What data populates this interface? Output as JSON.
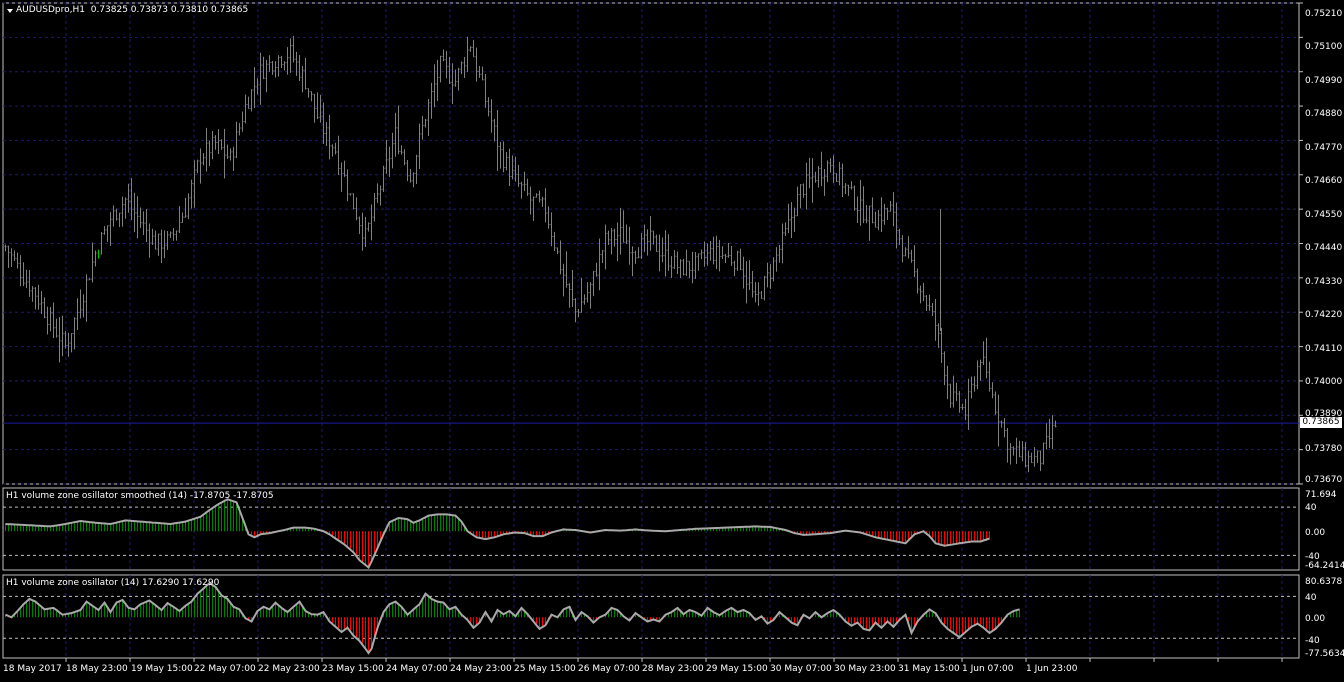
{
  "main_header": {
    "symbol_tf": "AUDUSDpro,H1",
    "ohlc": "0.73825 0.73873 0.73810 0.73865"
  },
  "osc1_header": "H1 volume zone osillator smoothed (14) -17.8705 -17.8705",
  "osc2_header": "H1 volume zone osillator (14) 17.6290 17.6290",
  "price_box": "0.73865",
  "colors": {
    "background": "#000000",
    "grid": "#1a1a70",
    "bars": "#808080",
    "last_up_bar": "#00c000",
    "positive": "#008000",
    "negative": "#ff0000",
    "oscillator_line": "#a9a9a9",
    "current_price_line": "#1a1aa0",
    "text": "#ffffff"
  },
  "chart_data": [
    {
      "type": "ohlc-bar",
      "title": "AUDUSDpro,H1",
      "ylim": [
        0.7367,
        0.7521
      ],
      "y_ticks": [
        "0.75210",
        "0.75100",
        "0.74990",
        "0.74880",
        "0.74770",
        "0.74660",
        "0.74550",
        "0.74440",
        "0.74330",
        "0.74220",
        "0.74110",
        "0.74000",
        "0.73890",
        "0.73780",
        "0.73670"
      ],
      "current_price": 0.73865,
      "x_ticks": [
        "18 May 2017",
        "18 May 23:00",
        "19 May 15:00",
        "22 May 07:00",
        "22 May 23:00",
        "23 May 15:00",
        "24 May 07:00",
        "24 May 23:00",
        "25 May 15:00",
        "26 May 07:00",
        "28 May 23:00",
        "29 May 15:00",
        "30 May 07:00",
        "30 May 23:00",
        "31 May 15:00",
        "1 Jun 07:00",
        "1 Jun 23:00"
      ],
      "close_anchors": [
        [
          0,
          0.7443
        ],
        [
          5,
          0.7435
        ],
        [
          10,
          0.7428
        ],
        [
          15,
          0.7419
        ],
        [
          20,
          0.7411
        ],
        [
          25,
          0.7425
        ],
        [
          30,
          0.7441
        ],
        [
          35,
          0.7452
        ],
        [
          40,
          0.7458
        ],
        [
          45,
          0.7451
        ],
        [
          50,
          0.7444
        ],
        [
          55,
          0.7445
        ],
        [
          60,
          0.7455
        ],
        [
          65,
          0.7472
        ],
        [
          70,
          0.7476
        ],
        [
          75,
          0.7471
        ],
        [
          80,
          0.7488
        ],
        [
          85,
          0.7499
        ],
        [
          90,
          0.7503
        ],
        [
          95,
          0.7505
        ],
        [
          100,
          0.7496
        ],
        [
          105,
          0.7482
        ],
        [
          110,
          0.7474
        ],
        [
          115,
          0.7459
        ],
        [
          120,
          0.7446
        ],
        [
          125,
          0.7462
        ],
        [
          130,
          0.7479
        ],
        [
          135,
          0.7465
        ],
        [
          140,
          0.7485
        ],
        [
          145,
          0.7501
        ],
        [
          150,
          0.7496
        ],
        [
          155,
          0.7508
        ],
        [
          160,
          0.749
        ],
        [
          165,
          0.7473
        ],
        [
          170,
          0.7464
        ],
        [
          175,
          0.7458
        ],
        [
          180,
          0.7455
        ],
        [
          185,
          0.7437
        ],
        [
          190,
          0.7422
        ],
        [
          195,
          0.743
        ],
        [
          200,
          0.7445
        ],
        [
          205,
          0.7447
        ],
        [
          210,
          0.7442
        ],
        [
          215,
          0.7445
        ],
        [
          220,
          0.744
        ],
        [
          225,
          0.7436
        ],
        [
          230,
          0.7437
        ],
        [
          235,
          0.7441
        ],
        [
          240,
          0.744
        ],
        [
          245,
          0.7438
        ],
        [
          250,
          0.7425
        ],
        [
          255,
          0.7435
        ],
        [
          260,
          0.7447
        ],
        [
          265,
          0.7461
        ],
        [
          270,
          0.7466
        ],
        [
          275,
          0.747
        ],
        [
          280,
          0.7462
        ],
        [
          285,
          0.7455
        ],
        [
          290,
          0.7452
        ],
        [
          295,
          0.7455
        ],
        [
          300,
          0.744
        ],
        [
          305,
          0.743
        ],
        [
          310,
          0.7418
        ],
        [
          315,
          0.7395
        ],
        [
          320,
          0.739
        ],
        [
          325,
          0.7408
        ],
        [
          330,
          0.7392
        ],
        [
          335,
          0.7378
        ],
        [
          340,
          0.7375
        ],
        [
          345,
          0.7375
        ],
        [
          350,
          0.7386
        ]
      ],
      "bar_count": 351
    },
    {
      "type": "histogram-line",
      "title": "H1 volume zone osillator smoothed (14)",
      "values_printed": [
        -17.8705,
        -17.8705
      ],
      "ylim": [
        -64.2414,
        71.694
      ],
      "y_ticks": [
        "71.694",
        "40",
        "0.00",
        "-40",
        "-64.2414"
      ],
      "levels": [
        40,
        -40
      ],
      "anchors": [
        [
          0,
          12
        ],
        [
          8,
          10
        ],
        [
          15,
          8
        ],
        [
          20,
          12
        ],
        [
          25,
          17
        ],
        [
          30,
          14
        ],
        [
          35,
          12
        ],
        [
          40,
          18
        ],
        [
          45,
          16
        ],
        [
          50,
          14
        ],
        [
          55,
          12
        ],
        [
          60,
          16
        ],
        [
          65,
          24
        ],
        [
          68,
          35
        ],
        [
          71,
          45
        ],
        [
          74,
          53
        ],
        [
          77,
          48
        ],
        [
          79,
          22
        ],
        [
          81,
          -5
        ],
        [
          83,
          -10
        ],
        [
          85,
          -5
        ],
        [
          88,
          -3
        ],
        [
          93,
          2
        ],
        [
          96,
          6
        ],
        [
          100,
          6
        ],
        [
          103,
          4
        ],
        [
          106,
          0
        ],
        [
          108,
          -5
        ],
        [
          110,
          -12
        ],
        [
          113,
          -22
        ],
        [
          116,
          -35
        ],
        [
          118,
          -48
        ],
        [
          120,
          -56
        ],
        [
          121,
          -60
        ],
        [
          122,
          -50
        ],
        [
          124,
          -28
        ],
        [
          126,
          -5
        ],
        [
          128,
          15
        ],
        [
          131,
          22
        ],
        [
          134,
          20
        ],
        [
          136,
          14
        ],
        [
          138,
          18
        ],
        [
          141,
          26
        ],
        [
          144,
          28
        ],
        [
          147,
          28
        ],
        [
          150,
          26
        ],
        [
          152,
          16
        ],
        [
          154,
          0
        ],
        [
          157,
          -10
        ],
        [
          160,
          -13
        ],
        [
          163,
          -10
        ],
        [
          166,
          -5
        ],
        [
          170,
          -2
        ],
        [
          173,
          -3
        ],
        [
          176,
          -8
        ],
        [
          179,
          -8
        ],
        [
          182,
          -2
        ],
        [
          186,
          3
        ],
        [
          190,
          2
        ],
        [
          195,
          -2
        ],
        [
          200,
          2
        ],
        [
          205,
          1
        ],
        [
          210,
          3
        ],
        [
          215,
          1
        ],
        [
          220,
          0
        ],
        [
          225,
          2
        ],
        [
          230,
          4
        ],
        [
          235,
          5
        ],
        [
          240,
          6
        ],
        [
          245,
          7
        ],
        [
          250,
          8
        ],
        [
          255,
          7
        ],
        [
          260,
          2
        ],
        [
          263,
          -3
        ],
        [
          266,
          -6
        ],
        [
          270,
          -5
        ],
        [
          275,
          -3
        ],
        [
          280,
          1
        ],
        [
          285,
          -2
        ],
        [
          290,
          -10
        ],
        [
          295,
          -15
        ],
        [
          298,
          -18
        ],
        [
          300,
          -20
        ],
        [
          303,
          -5
        ],
        [
          306,
          0
        ],
        [
          308,
          -8
        ],
        [
          310,
          -20
        ],
        [
          313,
          -24
        ],
        [
          318,
          -20
        ],
        [
          322,
          -17
        ],
        [
          325,
          -17
        ],
        [
          328,
          -12
        ]
      ]
    },
    {
      "type": "histogram-line",
      "title": "H1 volume zone osillator (14)",
      "values_printed": [
        17.629,
        17.629
      ],
      "ylim": [
        -77.5634,
        80.6378
      ],
      "y_ticks": [
        "80.6378",
        "40",
        "0.00",
        "-40",
        "-77.5634"
      ],
      "levels": [
        40,
        -40
      ],
      "anchors": [
        [
          0,
          5
        ],
        [
          2,
          0
        ],
        [
          4,
          12
        ],
        [
          6,
          25
        ],
        [
          8,
          35
        ],
        [
          10,
          30
        ],
        [
          13,
          15
        ],
        [
          16,
          18
        ],
        [
          19,
          5
        ],
        [
          22,
          8
        ],
        [
          25,
          14
        ],
        [
          27,
          30
        ],
        [
          29,
          22
        ],
        [
          31,
          14
        ],
        [
          33,
          28
        ],
        [
          35,
          10
        ],
        [
          37,
          28
        ],
        [
          39,
          33
        ],
        [
          41,
          18
        ],
        [
          43,
          15
        ],
        [
          45,
          25
        ],
        [
          48,
          32
        ],
        [
          50,
          23
        ],
        [
          52,
          14
        ],
        [
          54,
          27
        ],
        [
          56,
          20
        ],
        [
          58,
          12
        ],
        [
          60,
          22
        ],
        [
          62,
          30
        ],
        [
          64,
          45
        ],
        [
          66,
          55
        ],
        [
          68,
          65
        ],
        [
          70,
          58
        ],
        [
          72,
          42
        ],
        [
          74,
          35
        ],
        [
          76,
          20
        ],
        [
          78,
          15
        ],
        [
          80,
          -2
        ],
        [
          82,
          -8
        ],
        [
          84,
          12
        ],
        [
          86,
          20
        ],
        [
          88,
          15
        ],
        [
          90,
          28
        ],
        [
          92,
          18
        ],
        [
          94,
          10
        ],
        [
          96,
          20
        ],
        [
          98,
          30
        ],
        [
          100,
          12
        ],
        [
          102,
          6
        ],
        [
          104,
          5
        ],
        [
          106,
          10
        ],
        [
          108,
          -8
        ],
        [
          110,
          -18
        ],
        [
          112,
          -28
        ],
        [
          114,
          -20
        ],
        [
          116,
          -35
        ],
        [
          118,
          -45
        ],
        [
          120,
          -60
        ],
        [
          121,
          -68
        ],
        [
          122,
          -60
        ],
        [
          124,
          -20
        ],
        [
          126,
          10
        ],
        [
          128,
          25
        ],
        [
          130,
          30
        ],
        [
          132,
          20
        ],
        [
          134,
          5
        ],
        [
          136,
          15
        ],
        [
          138,
          25
        ],
        [
          140,
          45
        ],
        [
          142,
          35
        ],
        [
          144,
          30
        ],
        [
          146,
          28
        ],
        [
          148,
          15
        ],
        [
          150,
          20
        ],
        [
          152,
          5
        ],
        [
          154,
          -5
        ],
        [
          156,
          -20
        ],
        [
          158,
          -10
        ],
        [
          160,
          10
        ],
        [
          162,
          -8
        ],
        [
          164,
          14
        ],
        [
          166,
          6
        ],
        [
          168,
          12
        ],
        [
          170,
          2
        ],
        [
          172,
          18
        ],
        [
          174,
          6
        ],
        [
          176,
          -8
        ],
        [
          178,
          -22
        ],
        [
          180,
          -15
        ],
        [
          182,
          5
        ],
        [
          184,
          0
        ],
        [
          186,
          15
        ],
        [
          188,
          20
        ],
        [
          190,
          -5
        ],
        [
          192,
          10
        ],
        [
          194,
          2
        ],
        [
          196,
          -10
        ],
        [
          198,
          0
        ],
        [
          200,
          5
        ],
        [
          202,
          18
        ],
        [
          204,
          14
        ],
        [
          206,
          2
        ],
        [
          208,
          -6
        ],
        [
          210,
          8
        ],
        [
          212,
          0
        ],
        [
          214,
          -8
        ],
        [
          216,
          -4
        ],
        [
          218,
          -8
        ],
        [
          220,
          5
        ],
        [
          222,
          10
        ],
        [
          224,
          18
        ],
        [
          226,
          6
        ],
        [
          228,
          14
        ],
        [
          230,
          10
        ],
        [
          232,
          3
        ],
        [
          234,
          18
        ],
        [
          236,
          10
        ],
        [
          238,
          4
        ],
        [
          240,
          12
        ],
        [
          242,
          18
        ],
        [
          244,
          10
        ],
        [
          246,
          14
        ],
        [
          248,
          8
        ],
        [
          250,
          -5
        ],
        [
          252,
          2
        ],
        [
          254,
          -12
        ],
        [
          256,
          -5
        ],
        [
          258,
          10
        ],
        [
          260,
          0
        ],
        [
          262,
          -10
        ],
        [
          264,
          -15
        ],
        [
          266,
          5
        ],
        [
          268,
          -2
        ],
        [
          270,
          10
        ],
        [
          272,
          0
        ],
        [
          274,
          8
        ],
        [
          276,
          14
        ],
        [
          278,
          5
        ],
        [
          280,
          -8
        ],
        [
          282,
          -16
        ],
        [
          284,
          -10
        ],
        [
          286,
          -22
        ],
        [
          288,
          -25
        ],
        [
          290,
          -10
        ],
        [
          292,
          -20
        ],
        [
          294,
          -8
        ],
        [
          296,
          -18
        ],
        [
          298,
          -5
        ],
        [
          300,
          5
        ],
        [
          302,
          -30
        ],
        [
          304,
          -8
        ],
        [
          306,
          5
        ],
        [
          308,
          15
        ],
        [
          310,
          8
        ],
        [
          312,
          -10
        ],
        [
          314,
          -22
        ],
        [
          316,
          -30
        ],
        [
          318,
          -38
        ],
        [
          320,
          -28
        ],
        [
          322,
          -18
        ],
        [
          324,
          -12
        ],
        [
          326,
          -20
        ],
        [
          328,
          -30
        ],
        [
          330,
          -22
        ],
        [
          332,
          -10
        ],
        [
          334,
          5
        ],
        [
          336,
          12
        ],
        [
          338,
          15
        ]
      ]
    }
  ]
}
